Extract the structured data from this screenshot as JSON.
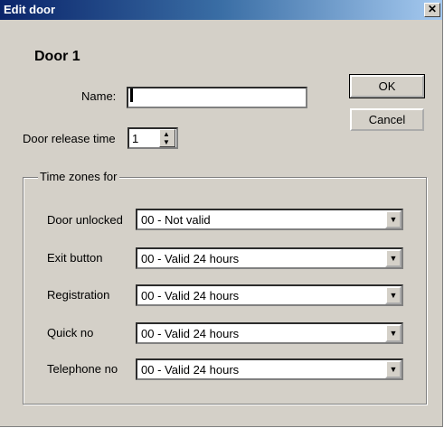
{
  "window": {
    "title": "Edit door",
    "close_glyph": "✕"
  },
  "door": {
    "heading": "Door 1"
  },
  "fields": {
    "name_label": "Name:",
    "name_value": "",
    "release_label": "Door release time",
    "release_value": "1"
  },
  "buttons": {
    "ok": "OK",
    "cancel": "Cancel"
  },
  "timezones": {
    "legend": "Time zones for",
    "rows": [
      {
        "label": "Door unlocked",
        "value": "00 - Not valid"
      },
      {
        "label": "Exit button",
        "value": "00 - Valid 24 hours"
      },
      {
        "label": "Registration",
        "value": "00 - Valid 24 hours"
      },
      {
        "label": "Quick no",
        "value": "00 - Valid 24 hours"
      },
      {
        "label": "Telephone no",
        "value": "00 - Valid 24 hours"
      }
    ]
  },
  "icons": {
    "spin_up": "▲",
    "spin_down": "▼",
    "dropdown": "▼"
  }
}
